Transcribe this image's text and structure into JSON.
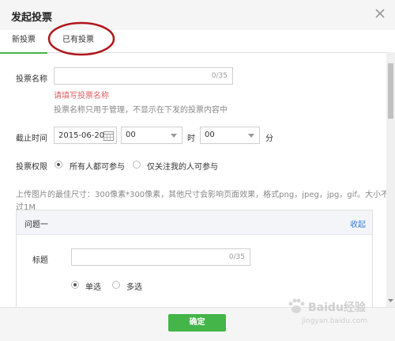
{
  "dialog": {
    "title": "发起投票"
  },
  "tabs": [
    {
      "label": "新投票",
      "active": true
    },
    {
      "label": "已有投票",
      "active": false
    }
  ],
  "form": {
    "name": {
      "label": "投票名称",
      "value": "",
      "counter": "0/35",
      "error": "请填写投票名称",
      "hint": "投票名称只用于管理，不显示在下发的投票内容中"
    },
    "deadline": {
      "label": "截止时间",
      "date": "2015-06-20",
      "hour": "00",
      "hour_unit": "时",
      "minute": "00",
      "minute_unit": "分"
    },
    "permission": {
      "label": "投票权限",
      "options": [
        {
          "label": "所有人都可参与",
          "selected": true
        },
        {
          "label": "仅关注我的人可参与",
          "selected": false
        }
      ]
    },
    "image_note_line1": "上传图片的最佳尺寸：300像素*300像素，其他尺寸会影响页面效果，格式png，jpeg，jpg，gif。大小不超",
    "image_note_line2": "过1M"
  },
  "question": {
    "title": "问题一",
    "collapse_label": "收起",
    "field_label": "标题",
    "field_value": "",
    "counter": "0/35",
    "types": [
      {
        "label": "单选",
        "selected": true
      },
      {
        "label": "多选",
        "selected": false
      }
    ]
  },
  "footer": {
    "confirm_label": "确定"
  },
  "watermark": {
    "text": "Baidu经验",
    "subtext": "jingyan.baidu.com"
  },
  "colors": {
    "accent": "#44b549",
    "error": "#e15f63",
    "link": "#2e7ed8",
    "highlight_circle": "#b0151c"
  }
}
